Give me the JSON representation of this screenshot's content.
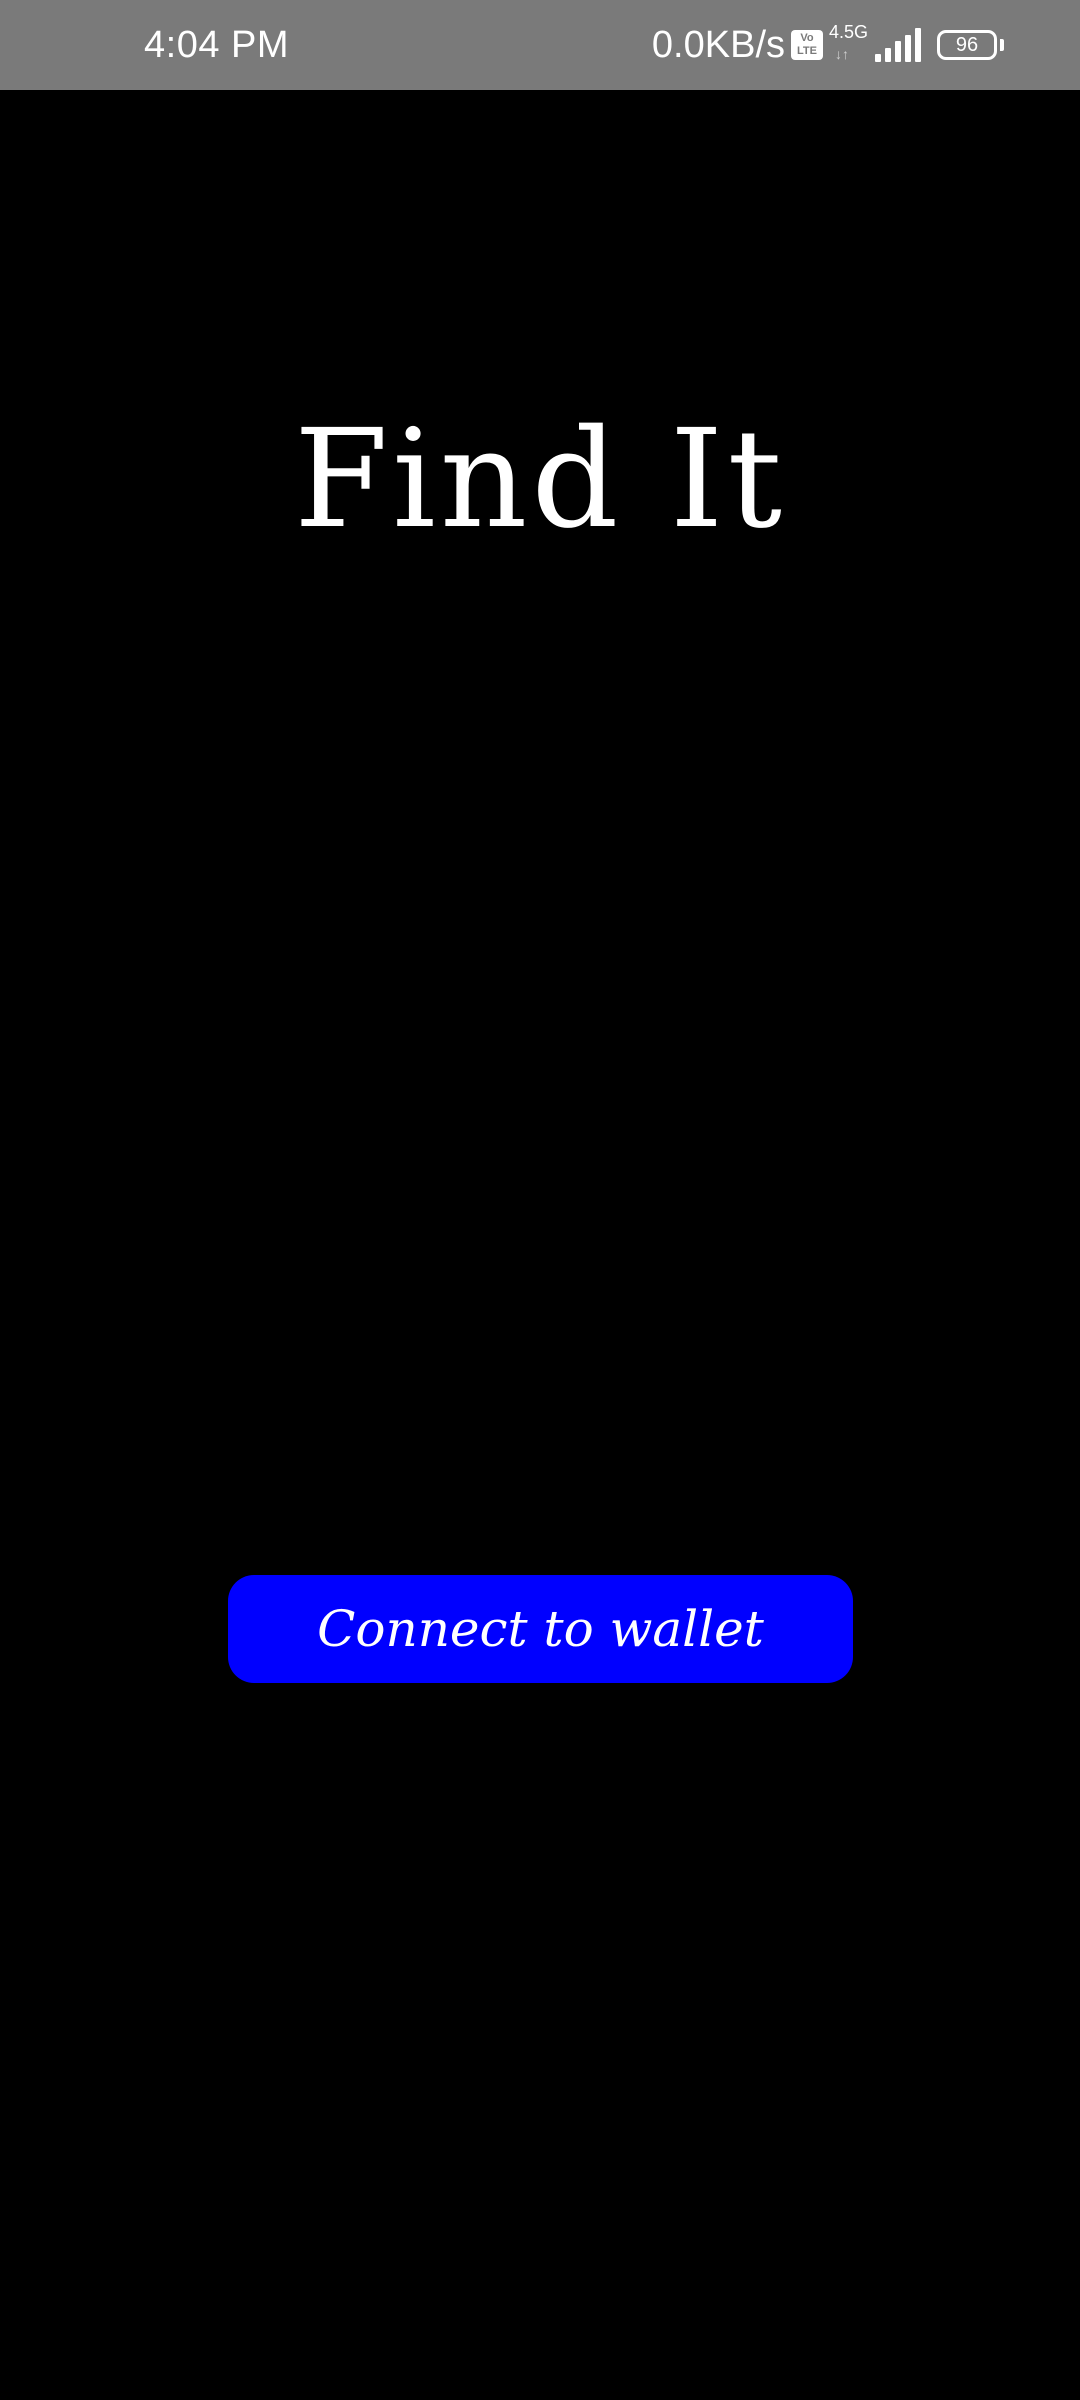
{
  "status_bar": {
    "time": "4:04 PM",
    "net_speed": "0.0KB/s",
    "volte_top": "Vo",
    "volte_bottom": "LTE",
    "network_type": "4.5G",
    "network_arrows": "↓↑",
    "signal_icon": "signal-bars-icon",
    "battery_level": "96"
  },
  "app": {
    "title": "Find It",
    "connect_button_label": "Connect to wallet"
  },
  "colors": {
    "status_bar_bg": "#7a7a7a",
    "background": "#000000",
    "button_bg": "#0000ff",
    "text": "#ffffff"
  }
}
